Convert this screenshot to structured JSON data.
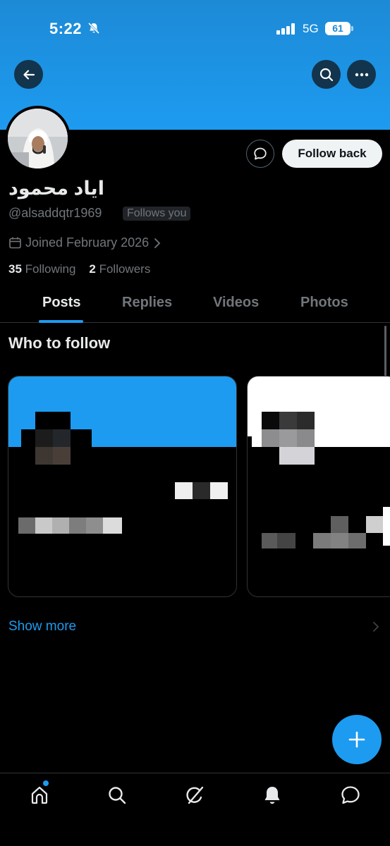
{
  "status_bar": {
    "time": "5:22",
    "network": "5G",
    "battery": "61"
  },
  "profile": {
    "display_name": "اياد محمود",
    "handle": "@alsaddqtr1969",
    "follows_you_badge": "Follows you",
    "joined": "Joined February 2026",
    "following_count": "35",
    "following_label": "Following",
    "followers_count": "2",
    "followers_label": "Followers",
    "follow_back_label": "Follow back"
  },
  "tabs": [
    {
      "label": "Posts",
      "active": true
    },
    {
      "label": "Replies",
      "active": false
    },
    {
      "label": "Videos",
      "active": false
    },
    {
      "label": "Photos",
      "active": false
    }
  ],
  "who_to_follow": {
    "title": "Who to follow",
    "show_more": "Show more"
  },
  "colors": {
    "accent": "#1d9bf0",
    "background": "#000000",
    "secondary_text": "#71767b",
    "primary_text": "#e7e9ea"
  },
  "icons": {
    "back": "arrow-left-icon",
    "search": "search-icon",
    "more": "more-horizontal-icon",
    "message": "message-bubble-icon",
    "calendar": "calendar-icon",
    "compose": "plus-icon",
    "nav": [
      "home-icon",
      "search-icon",
      "grok-icon",
      "bell-icon",
      "message-icon"
    ]
  }
}
